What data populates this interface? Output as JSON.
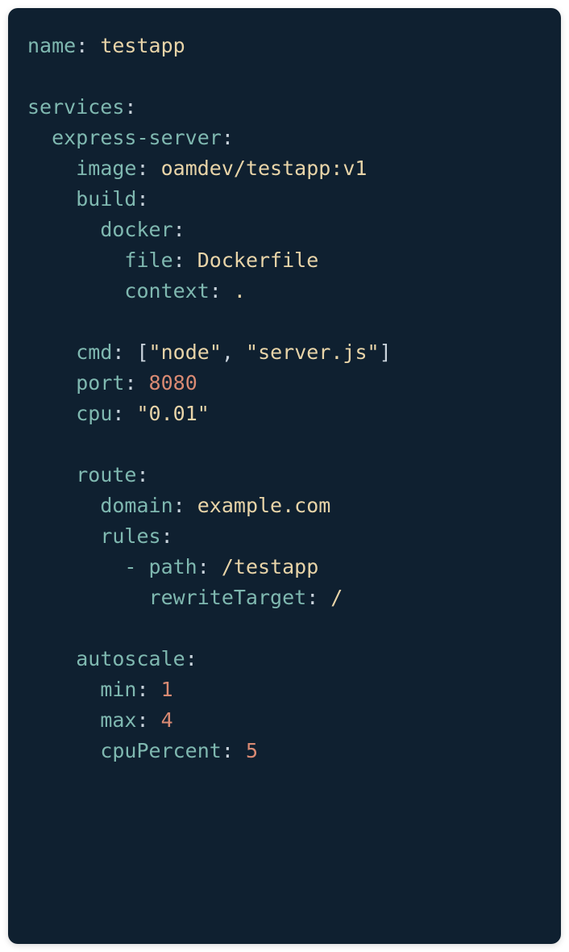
{
  "yaml": {
    "name_key": "name",
    "name_val": "testapp",
    "services_key": "services",
    "service_name": "express-server",
    "image_key": "image",
    "image_val": "oamdev/testapp:v1",
    "build_key": "build",
    "docker_key": "docker",
    "file_key": "file",
    "file_val": "Dockerfile",
    "context_key": "context",
    "context_val": ".",
    "cmd_key": "cmd",
    "cmd_open": "[",
    "cmd_q1": "\"",
    "cmd_v1": "node",
    "cmd_q2": "\"",
    "cmd_comma": ", ",
    "cmd_q3": "\"",
    "cmd_v2": "server.js",
    "cmd_q4": "\"",
    "cmd_close": "]",
    "port_key": "port",
    "port_val": "8080",
    "cpu_key": "cpu",
    "cpu_q1": "\"",
    "cpu_val": "0.01",
    "cpu_q2": "\"",
    "route_key": "route",
    "domain_key": "domain",
    "domain_val": "example.com",
    "rules_key": "rules",
    "rules_dash": "- ",
    "path_key": "path",
    "path_val": "/testapp",
    "rewrite_key": "rewriteTarget",
    "rewrite_val": "/",
    "autoscale_key": "autoscale",
    "min_key": "min",
    "min_val": "1",
    "max_key": "max",
    "max_val": "4",
    "cpuPercent_key": "cpuPercent",
    "cpuPercent_val": "5"
  }
}
